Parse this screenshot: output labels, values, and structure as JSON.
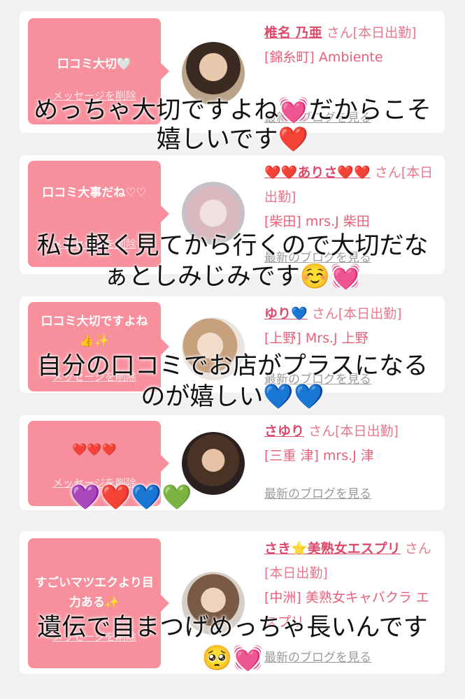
{
  "cards": [
    {
      "message": "口コミ大切🤍",
      "delete_label": "メッセージを削除",
      "name": "椎名 乃亜",
      "suffix": "さん[本日出勤]",
      "location": "[錦糸町] Ambiente",
      "blog_label": "最新のブログを見る"
    },
    {
      "message": "口コミ大事だね♡♡",
      "delete_label": "メッセージを削除",
      "name": "❤️❤️ありさ❤️❤️",
      "suffix": "さん[本日出勤]",
      "location": "[柴田] mrs.J 柴田",
      "blog_label": "最新のブログを見る"
    },
    {
      "message": "口コミ大切ですよね👍✨",
      "delete_label": "メッセージを削除",
      "name": "ゆり💙",
      "suffix": "さん[本日出勤]",
      "location": "[上野] Mrs.J 上野",
      "blog_label": "最新のブログを見る"
    },
    {
      "message": "❤️❤️❤️",
      "delete_label": "メッセージを削除",
      "name": "さゆり",
      "suffix": "さん[本日出勤]",
      "location": "[三重 津] mrs.J 津",
      "blog_label": "最新のブログを見る"
    },
    {
      "message": "すごいマツエクより目力ある✨",
      "delete_label": "メッセージを削除",
      "name": "さき⭐美熟女エスプリ",
      "suffix": "さん[本日出勤]",
      "location": "[中洲] 美熟女キャバクラ エスプリ",
      "blog_label": "最新のブログを見る"
    }
  ],
  "captions": [
    "めっちゃ大切ですよね💓だからこそ",
    "嬉しいです❤️",
    "私も軽く見てから行くので大切だな",
    "ぁとしみじみです☺️💓",
    "自分の口コミでお店がプラスになる",
    "のが嬉しい💙💙",
    "💜❤️💙💚",
    "遺伝で自まつげめっちゃ長いんです",
    "🥺💓"
  ],
  "colors": {
    "background": "#f1f1f3",
    "bubble": "#f7909c",
    "name": "#dd4a6a",
    "link_gray": "#9a9a9a"
  }
}
